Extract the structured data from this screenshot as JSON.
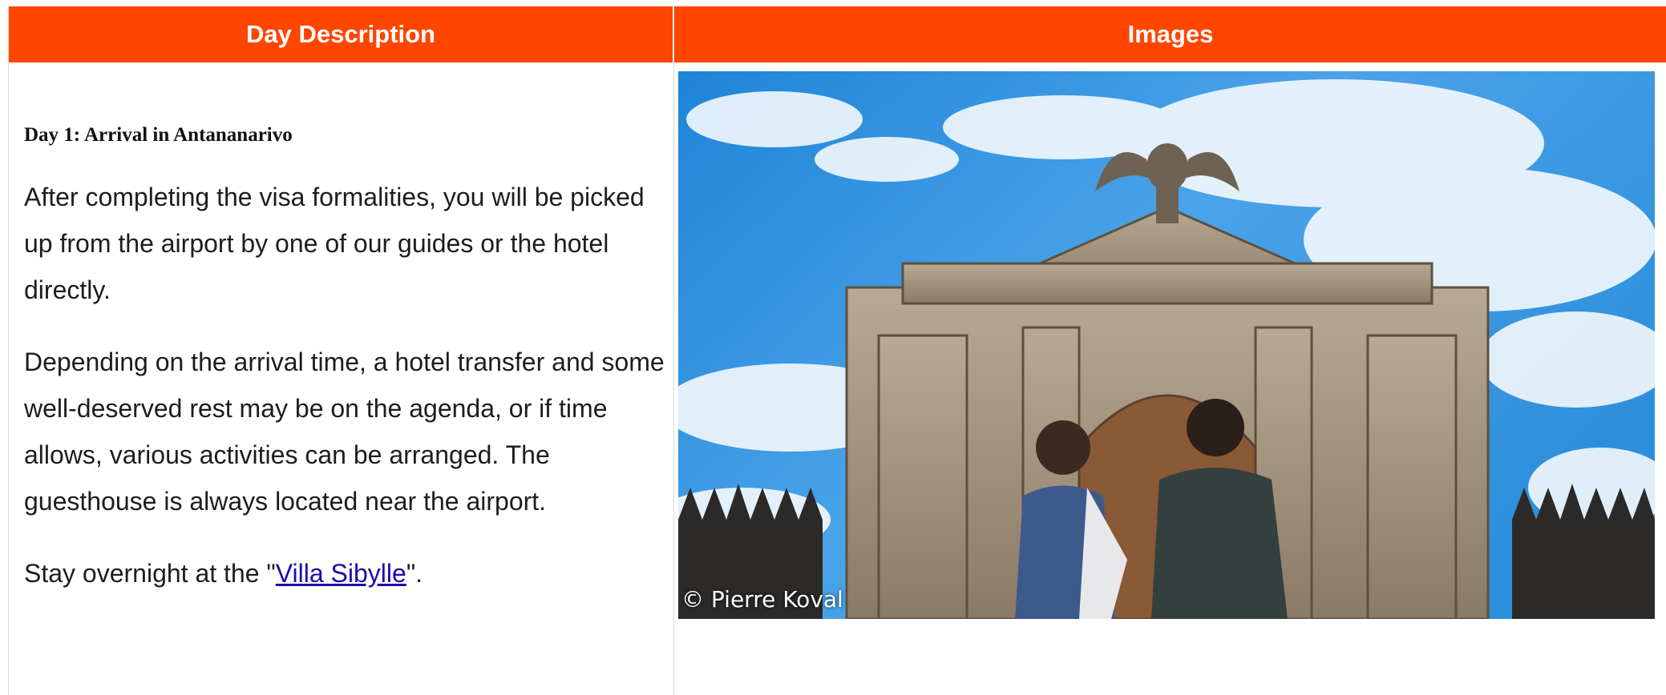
{
  "header": {
    "col_day": "Day Description",
    "col_images": "Images"
  },
  "day": {
    "title": "Day 1: Arrival in Antananarivo",
    "paragraph1": "After completing the visa formalities, you will be picked up from the airport by one of our guides or the hotel directly.",
    "paragraph2": "Depending on the arrival time, a hotel transfer and some well-deserved rest may be on the agenda, or if time allows, various activities can be arranged. The guesthouse is always located near the airport.",
    "stay_prefix": "Stay overnight at the \"",
    "stay_link": "Villa Sibylle",
    "stay_suffix": "\"."
  },
  "image": {
    "credit": "© Pierre Koval",
    "subject": "stone-arch-monument-with-eagle"
  },
  "colors": {
    "header_bg": "#ff4500",
    "link": "#1a0dab"
  }
}
